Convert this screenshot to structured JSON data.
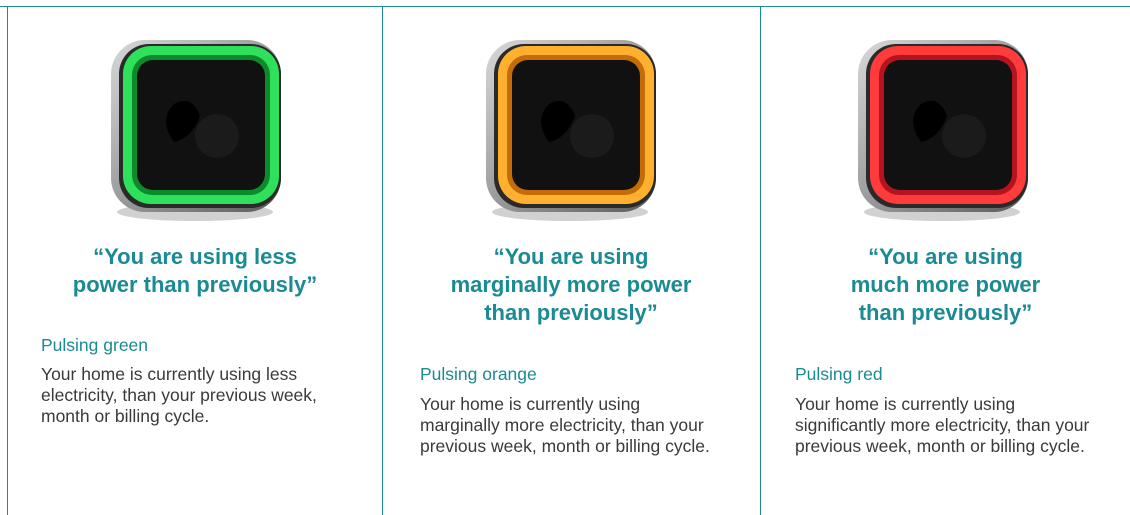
{
  "cards": [
    {
      "glow_color": "#2fe05a",
      "glow_dark": "#0d8a2c",
      "quote_line1": "“You are using less",
      "quote_line2": "power than previously”",
      "quote_line3": "",
      "mode": "Pulsing green",
      "description": "Your home is currently using less electricity, than your previous week, month or billing cycle."
    },
    {
      "glow_color": "#ffb02e",
      "glow_dark": "#c46d08",
      "quote_line1": "“You are using",
      "quote_line2": "marginally more power",
      "quote_line3": "than previously”",
      "mode": "Pulsing orange",
      "description": "Your home is currently using marginally more electricity, than your previous week, month or billing cycle."
    },
    {
      "glow_color": "#ff3b3b",
      "glow_dark": "#b3141e",
      "quote_line1": "“You are using",
      "quote_line2": "much more power",
      "quote_line3": "than previously”",
      "mode": "Pulsing red",
      "description": "Your home is currently using significantly more electricity, than your previous week, month or billing cycle."
    }
  ],
  "colors": {
    "accent": "#1a8a93",
    "body_text": "#3a3a3a"
  }
}
